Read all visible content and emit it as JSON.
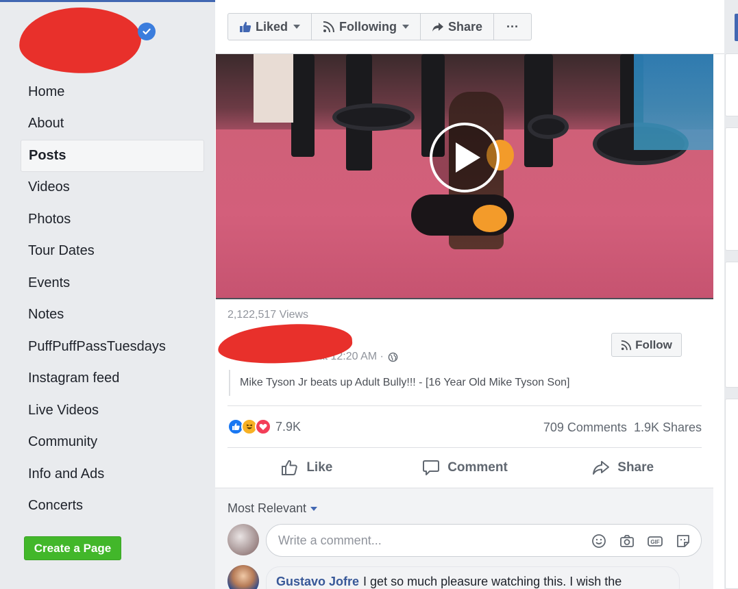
{
  "sidebar": {
    "nav": [
      {
        "label": "Home",
        "active": false
      },
      {
        "label": "About",
        "active": false
      },
      {
        "label": "Posts",
        "active": true
      },
      {
        "label": "Videos",
        "active": false
      },
      {
        "label": "Photos",
        "active": false
      },
      {
        "label": "Tour Dates",
        "active": false
      },
      {
        "label": "Events",
        "active": false
      },
      {
        "label": "Notes",
        "active": false
      },
      {
        "label": "PuffPuffPassTuesdays",
        "active": false
      },
      {
        "label": "Instagram feed",
        "active": false
      },
      {
        "label": "Live Videos",
        "active": false
      },
      {
        "label": "Community",
        "active": false
      },
      {
        "label": "Info and Ads",
        "active": false
      },
      {
        "label": "Concerts",
        "active": false
      }
    ],
    "create_page": "Create a Page"
  },
  "actionbar": {
    "liked": "Liked",
    "following": "Following",
    "share": "Share",
    "more": "···"
  },
  "post": {
    "views": "2,122,517 Views",
    "time": "April 21 at 12:20 AM ·",
    "follow": "Follow",
    "caption": "Mike Tyson Jr beats up Adult Bully!!! - [16 Year Old Mike Tyson Son]",
    "reaction_count": "7.9K",
    "comments": "709 Comments",
    "shares": "1.9K Shares",
    "like": "Like",
    "comment": "Comment",
    "share": "Share"
  },
  "comments": {
    "sort": "Most Relevant",
    "placeholder": "Write a comment...",
    "first": {
      "author": "Gustavo Jofre",
      "text": "I get so much pleasure watching this. I wish the"
    }
  },
  "colors": {
    "brand": "#4267b2",
    "create_page": "#42b72a",
    "link": "#385898",
    "redaction": "#e8302b"
  }
}
